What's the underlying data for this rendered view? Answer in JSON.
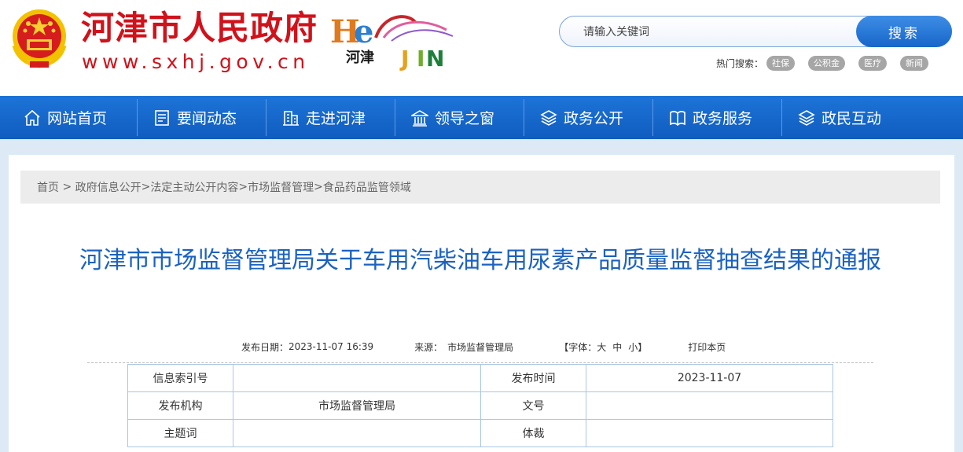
{
  "header": {
    "site_title": "河津市人民政府",
    "site_url": "www.sxhj.gov.cn",
    "logo_text_cn": "河津",
    "search": {
      "placeholder": "请输入关键词",
      "button_label": "搜索"
    },
    "hot_search": {
      "label": "热门搜索：",
      "tags": [
        "社保",
        "公积金",
        "医疗",
        "新闻"
      ]
    }
  },
  "nav": {
    "items": [
      {
        "label": "网站首页",
        "icon": "home-icon"
      },
      {
        "label": "要闻动态",
        "icon": "news-icon"
      },
      {
        "label": "走进河津",
        "icon": "building-icon"
      },
      {
        "label": "领导之窗",
        "icon": "government-icon"
      },
      {
        "label": "政务公开",
        "icon": "layers-icon"
      },
      {
        "label": "政务服务",
        "icon": "service-icon"
      },
      {
        "label": "政民互动",
        "icon": "layers-icon"
      }
    ]
  },
  "breadcrumb": {
    "items": [
      "首页",
      "政府信息公开",
      "法定主动公开内容",
      "市场监督管理",
      "食品药品监管领域"
    ],
    "sep_first": " > ",
    "sep": ">"
  },
  "article": {
    "title": "河津市市场监督管理局关于车用汽柴油车用尿素产品质量监督抽查结果的通报",
    "publish_date_label": "发布日期：",
    "publish_date": "2023-11-07 16:39",
    "source_label": "来源：",
    "source": "市场监督管理局",
    "font_size_label": "【字体：",
    "font_large": "大",
    "font_medium": "中",
    "font_small": "小",
    "font_size_end": "】",
    "print_label": "打印本页"
  },
  "info_table": {
    "rows": [
      {
        "k1": "信息索引号",
        "v1": "",
        "k2": "发布时间",
        "v2": "2023-11-07"
      },
      {
        "k1": "发布机构",
        "v1": "市场监督管理局",
        "k2": "文号",
        "v2": ""
      },
      {
        "k1": "主题词",
        "v1": "",
        "k2": "体裁",
        "v2": ""
      }
    ]
  },
  "colors": {
    "brand_red": "#d0121b",
    "nav_blue": "#1766c9",
    "title_blue": "#1b62c0"
  }
}
